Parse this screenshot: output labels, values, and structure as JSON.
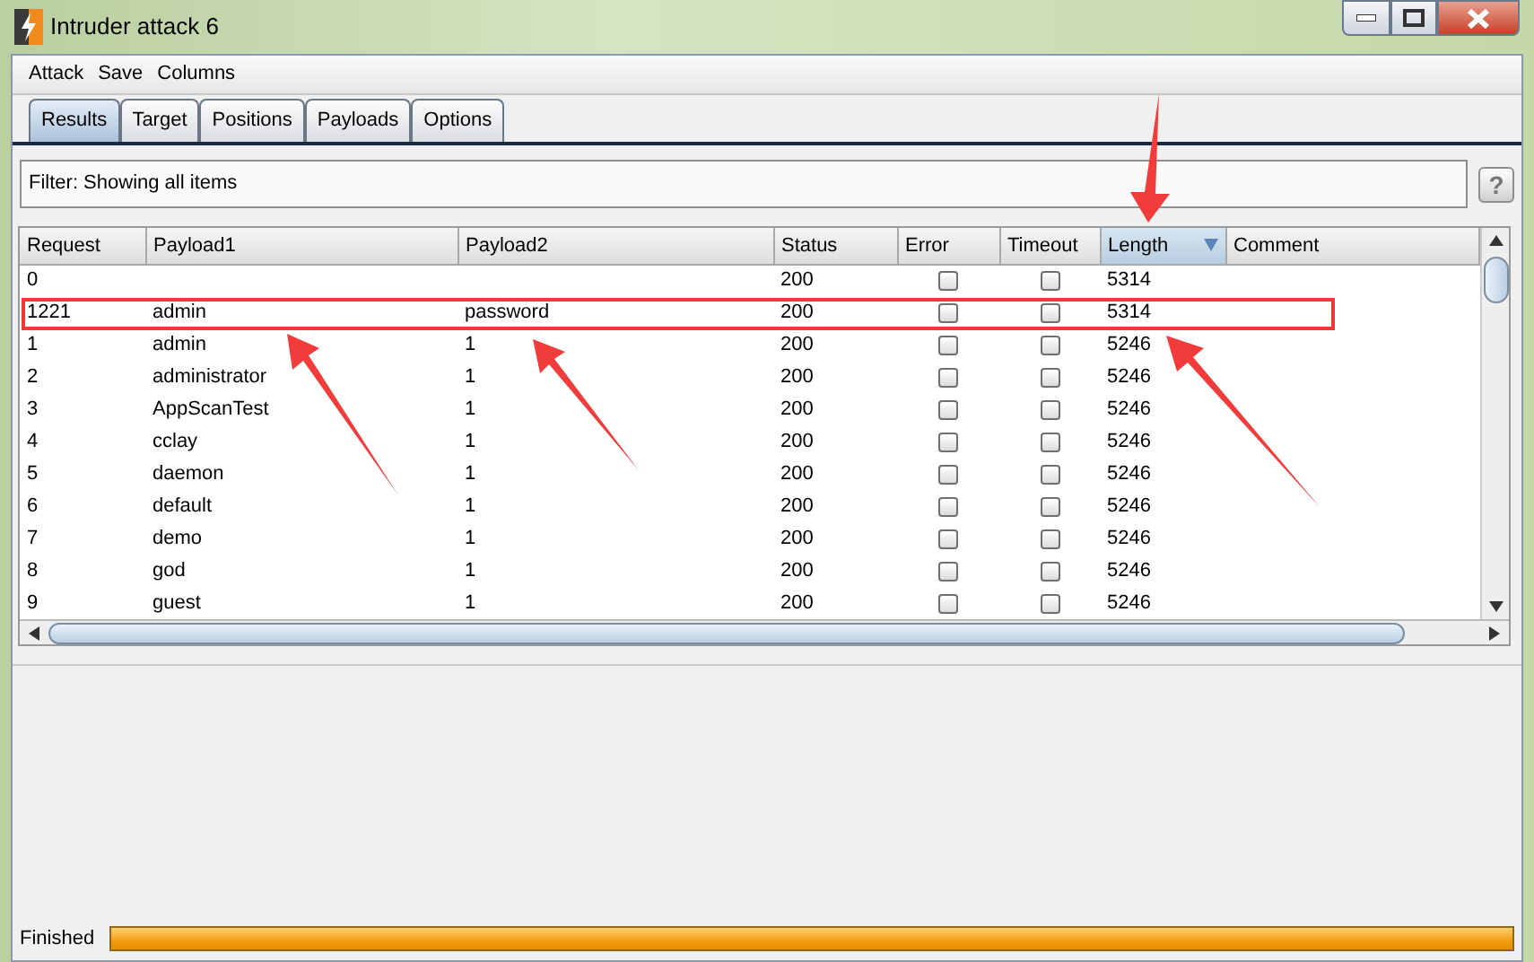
{
  "window": {
    "title": "Intruder attack 6"
  },
  "menu": [
    "Attack",
    "Save",
    "Columns"
  ],
  "tabs": [
    {
      "label": "Results",
      "selected": true
    },
    {
      "label": "Target",
      "selected": false
    },
    {
      "label": "Positions",
      "selected": false
    },
    {
      "label": "Payloads",
      "selected": false
    },
    {
      "label": "Options",
      "selected": false
    }
  ],
  "filter": {
    "text": "Filter:  Showing all items",
    "help": "?"
  },
  "table": {
    "columns": [
      {
        "label": "Request",
        "sorted": false
      },
      {
        "label": "Payload1",
        "sorted": false
      },
      {
        "label": "Payload2",
        "sorted": false
      },
      {
        "label": "Status",
        "sorted": false
      },
      {
        "label": "Error",
        "sorted": false
      },
      {
        "label": "Timeout",
        "sorted": false
      },
      {
        "label": "Length",
        "sorted": true
      },
      {
        "label": "Comment",
        "sorted": false
      }
    ],
    "rows": [
      {
        "request": "0",
        "payload1": "",
        "payload2": "",
        "status": "200",
        "error": false,
        "timeout": false,
        "length": "5314",
        "highlighted": false
      },
      {
        "request": "1221",
        "payload1": "admin",
        "payload2": "password",
        "status": "200",
        "error": false,
        "timeout": false,
        "length": "5314",
        "highlighted": true
      },
      {
        "request": "1",
        "payload1": "admin",
        "payload2": "1",
        "status": "200",
        "error": false,
        "timeout": false,
        "length": "5246",
        "highlighted": false
      },
      {
        "request": "2",
        "payload1": "administrator",
        "payload2": "1",
        "status": "200",
        "error": false,
        "timeout": false,
        "length": "5246",
        "highlighted": false
      },
      {
        "request": "3",
        "payload1": "AppScanTest",
        "payload2": "1",
        "status": "200",
        "error": false,
        "timeout": false,
        "length": "5246",
        "highlighted": false
      },
      {
        "request": "4",
        "payload1": "cclay",
        "payload2": "1",
        "status": "200",
        "error": false,
        "timeout": false,
        "length": "5246",
        "highlighted": false
      },
      {
        "request": "5",
        "payload1": "daemon",
        "payload2": "1",
        "status": "200",
        "error": false,
        "timeout": false,
        "length": "5246",
        "highlighted": false
      },
      {
        "request": "6",
        "payload1": "default",
        "payload2": "1",
        "status": "200",
        "error": false,
        "timeout": false,
        "length": "5246",
        "highlighted": false
      },
      {
        "request": "7",
        "payload1": "demo",
        "payload2": "1",
        "status": "200",
        "error": false,
        "timeout": false,
        "length": "5246",
        "highlighted": false
      },
      {
        "request": "8",
        "payload1": "god",
        "payload2": "1",
        "status": "200",
        "error": false,
        "timeout": false,
        "length": "5246",
        "highlighted": false
      },
      {
        "request": "9",
        "payload1": "guest",
        "payload2": "1",
        "status": "200",
        "error": false,
        "timeout": false,
        "length": "5246",
        "highlighted": false
      }
    ]
  },
  "status_bar": {
    "text": "Finished",
    "level": 1
  }
}
